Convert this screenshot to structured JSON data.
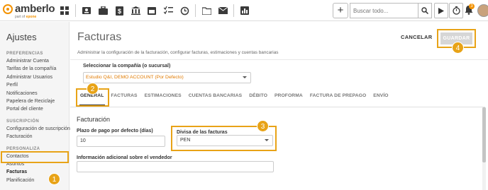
{
  "topbar": {
    "logo_text": "amberlo",
    "logo_sub_prefix": "part of",
    "logo_sub_brand": "epone",
    "nav_icons": [
      "dashboard-icon",
      "contacts-card-icon",
      "briefcase-icon",
      "billing-doc-icon",
      "bank-icon",
      "calendar-icon",
      "checklist-icon",
      "history-icon",
      "folder-icon",
      "mail-icon",
      "reports-icon"
    ],
    "plus_label": "+",
    "search_placeholder": "Buscar todo...",
    "notification_count": "3"
  },
  "sidebar": {
    "title": "Ajustes",
    "sections": [
      {
        "heading": "PREFERENCIAS",
        "items": [
          "Administrar Cuenta",
          "Tarifas de la compañía",
          "Administrar Usuarios",
          "Perfil",
          "Notificaciones",
          "Papelera de Reciclaje",
          "Portal del cliente"
        ]
      },
      {
        "heading": "SUSCRIPCIÓN",
        "items": [
          "Configuración de suscripción",
          "Facturación"
        ]
      },
      {
        "heading": "PERSONALIZA",
        "items": [
          "Contactos",
          "Asuntos",
          "Facturas",
          "Planificación"
        ]
      }
    ],
    "active_item": "Facturas"
  },
  "header": {
    "title": "Facturas",
    "description": "Administrar la configuración de la facturación, configurar facturas, estimaciones y cuentas bancarias",
    "cancel_label": "CANCELAR",
    "save_label": "GUARDAR"
  },
  "company": {
    "label": "Seleccionar la compañía (o sucursal)",
    "value": "Estudio Q&I, DEMO ACCOUNT (Por Defecto)"
  },
  "tabs": [
    "GENERAL",
    "FACTURAS",
    "ESTIMACIONES",
    "CUENTAS BANCARIAS",
    "DÉBITO",
    "PROFORMA",
    "FACTURA DE PREPAGO",
    "ENVÍO"
  ],
  "active_tab": "GENERAL",
  "form": {
    "section_title": "Facturación",
    "payment_term_label": "Plazo de pago por defecto (días)",
    "payment_term_value": "10",
    "currency_label": "Divisa de las facturas",
    "currency_value": "PEN",
    "seller_info_label": "Información adicional sobre el vendedor",
    "seller_info_value": ""
  },
  "steps": [
    "1",
    "2",
    "3",
    "4"
  ],
  "colors": {
    "accent": "#f39200",
    "highlight": "#e8a317",
    "company_value": "#e07a00",
    "save_disabled": "#d6d6d6"
  }
}
